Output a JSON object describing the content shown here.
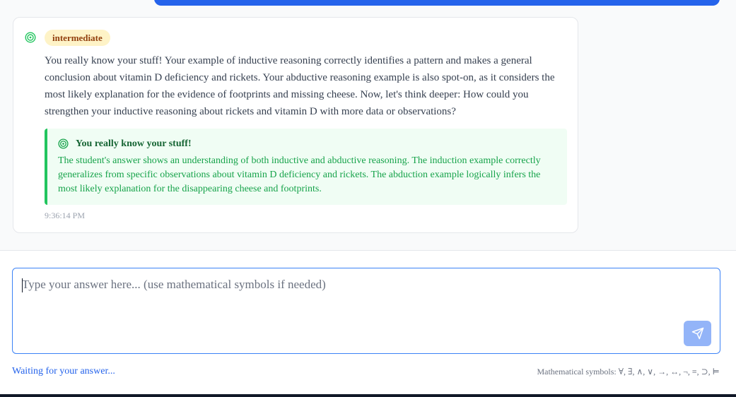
{
  "message": {
    "level_badge": "intermediate",
    "text": "You really know your stuff! Your example of inductive reasoning correctly identifies a pattern and makes a general conclusion about vitamin D deficiency and rickets. Your abductive reasoning example is also spot-on, as it considers the most likely explanation for the evidence of footprints and missing cheese. Now, let's think deeper: How could you strengthen your inductive reasoning about rickets and vitamin D with more data or observations?",
    "feedback": {
      "title": "You really know your stuff!",
      "text": "The student's answer shows an understanding of both inductive and abductive reasoning. The induction example correctly generalizes from specific observations about vitamin D deficiency and rickets. The abduction example logically infers the most likely explanation for the disappearing cheese and footprints."
    },
    "timestamp": "9:36:14 PM"
  },
  "input": {
    "placeholder": "Type your answer here... (use mathematical symbols if needed)",
    "value": ""
  },
  "status": "Waiting for your answer...",
  "symbols_hint": "Mathematical symbols: ∀, ∃, ∧, ∨, →, ↔, ¬, ≡, ⊃, ⊨",
  "colors": {
    "accent": "#2563eb",
    "badge_bg": "#fef3c7",
    "badge_text": "#92400e",
    "feedback_bg": "#f0fdf4",
    "feedback_border": "#22c55e",
    "feedback_text": "#16a34a",
    "send_button": "#93b4f8"
  },
  "icons": {
    "message": "target-icon",
    "feedback": "target-icon",
    "send": "send-icon"
  }
}
